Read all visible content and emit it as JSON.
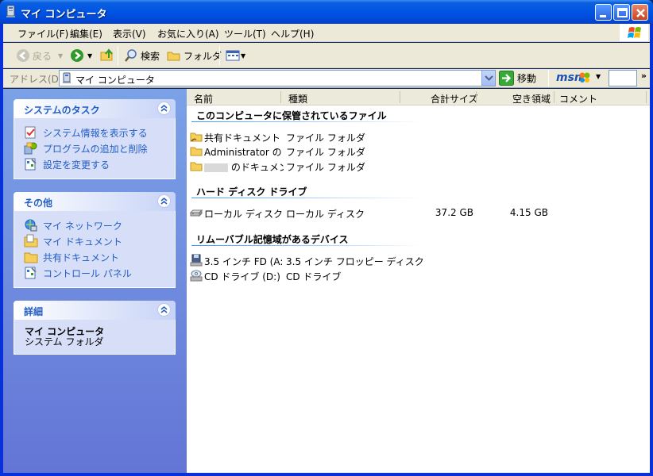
{
  "window": {
    "title": "マイ コンピュータ"
  },
  "menu": [
    {
      "label": "ファイル(F)"
    },
    {
      "label": "編集(E)"
    },
    {
      "label": "表示(V)"
    },
    {
      "label": "お気に入り(A)"
    },
    {
      "label": "ツール(T)"
    },
    {
      "label": "ヘルプ(H)"
    }
  ],
  "toolbar": {
    "back_label": "戻る",
    "search_label": "検索",
    "folders_label": "フォルダ"
  },
  "address": {
    "label": "アドレス(D)",
    "value": "マイ コンピュータ",
    "go_label": "移動",
    "msn_label": "msn",
    "chevron": "»"
  },
  "left_pane": {
    "system_tasks": {
      "title": "システムのタスク",
      "items": [
        {
          "label": "システム情報を表示する",
          "icon": "system-info-icon"
        },
        {
          "label": "プログラムの追加と削除",
          "icon": "add-remove-programs-icon"
        },
        {
          "label": "設定を変更する",
          "icon": "control-panel-icon"
        }
      ]
    },
    "other_places": {
      "title": "その他",
      "items": [
        {
          "label": "マイ ネットワーク",
          "icon": "network-icon"
        },
        {
          "label": "マイ ドキュメント",
          "icon": "my-documents-icon"
        },
        {
          "label": "共有ドキュメント",
          "icon": "folder-icon"
        },
        {
          "label": "コントロール パネル",
          "icon": "control-panel-icon"
        }
      ]
    },
    "details": {
      "title": "詳細",
      "name": "マイ コンピュータ",
      "type": "システム フォルダ"
    }
  },
  "columns": [
    "名前",
    "種類",
    "合計サイズ",
    "空き領域",
    "コメント"
  ],
  "groups": {
    "stored_files": {
      "title": "このコンピュータに保管されているファイル",
      "items": [
        {
          "name": "共有ドキュメント",
          "type": "ファイル フォルダ"
        },
        {
          "name": "Administrator の...",
          "type": "ファイル フォルダ"
        },
        {
          "name": "のドキュメント",
          "type": "ファイル フォルダ"
        }
      ]
    },
    "hard_disks": {
      "title": "ハード ディスク ドライブ",
      "items": [
        {
          "name": "ローカル ディスク (...",
          "type": "ローカル ディスク",
          "size": "37.2 GB",
          "free": "4.15 GB"
        }
      ]
    },
    "removable": {
      "title": "リムーバブル記憶域があるデバイス",
      "items": [
        {
          "name": "3.5 インチ FD (A:)",
          "type": "3.5 インチ フロッピー ディスク"
        },
        {
          "name": "CD ドライブ (D:)",
          "type": "CD ドライブ"
        }
      ]
    }
  },
  "colors": {
    "titlebar": "#0054e3",
    "task_link": "#215dc6",
    "left_pane_top": "#7ba2e7",
    "left_pane_bottom": "#6375d6"
  }
}
